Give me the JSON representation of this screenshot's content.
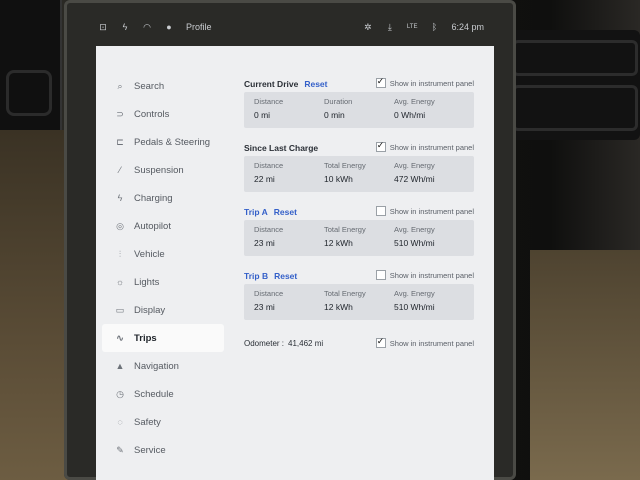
{
  "status": {
    "profile": "Profile",
    "time": "6:24 pm",
    "lte": "LTE"
  },
  "sidebar": {
    "items": [
      {
        "label": "Search",
        "icon": "search-icon"
      },
      {
        "label": "Controls",
        "icon": "toggle-icon"
      },
      {
        "label": "Pedals & Steering",
        "icon": "car-icon"
      },
      {
        "label": "Suspension",
        "icon": "suspension-icon"
      },
      {
        "label": "Charging",
        "icon": "bolt-icon"
      },
      {
        "label": "Autopilot",
        "icon": "steering-wheel-icon"
      },
      {
        "label": "Vehicle",
        "icon": "sliders-icon"
      },
      {
        "label": "Lights",
        "icon": "lightbulb-icon"
      },
      {
        "label": "Display",
        "icon": "display-icon"
      },
      {
        "label": "Trips",
        "icon": "trips-icon"
      },
      {
        "label": "Navigation",
        "icon": "navigation-arrow-icon"
      },
      {
        "label": "Schedule",
        "icon": "clock-icon"
      },
      {
        "label": "Safety",
        "icon": "shield-icon"
      },
      {
        "label": "Service",
        "icon": "wrench-icon"
      }
    ],
    "active": "Trips"
  },
  "trips": {
    "show_label": "Show in instrument panel",
    "current": {
      "title": "Current Drive",
      "reset": "Reset",
      "show_checked": true,
      "distance_label": "Distance",
      "distance": "0 mi",
      "duration_label": "Duration",
      "duration": "0 min",
      "energy_label": "Avg. Energy",
      "energy": "0 Wh/mi"
    },
    "since": {
      "title": "Since Last Charge",
      "show_checked": true,
      "distance_label": "Distance",
      "distance": "22 mi",
      "total_label": "Total Energy",
      "total": "10 kWh",
      "energy_label": "Avg. Energy",
      "energy": "472 Wh/mi"
    },
    "trip_a": {
      "title": "Trip A",
      "reset": "Reset",
      "show_checked": false,
      "distance_label": "Distance",
      "distance": "23 mi",
      "total_label": "Total Energy",
      "total": "12 kWh",
      "energy_label": "Avg. Energy",
      "energy": "510 Wh/mi"
    },
    "trip_b": {
      "title": "Trip B",
      "reset": "Reset",
      "show_checked": false,
      "distance_label": "Distance",
      "distance": "23 mi",
      "total_label": "Total Energy",
      "total": "12 kWh",
      "energy_label": "Avg. Energy",
      "energy": "510 Wh/mi"
    },
    "odometer": {
      "label": "Odometer :",
      "value": "41,462 mi",
      "show_checked": true
    }
  }
}
